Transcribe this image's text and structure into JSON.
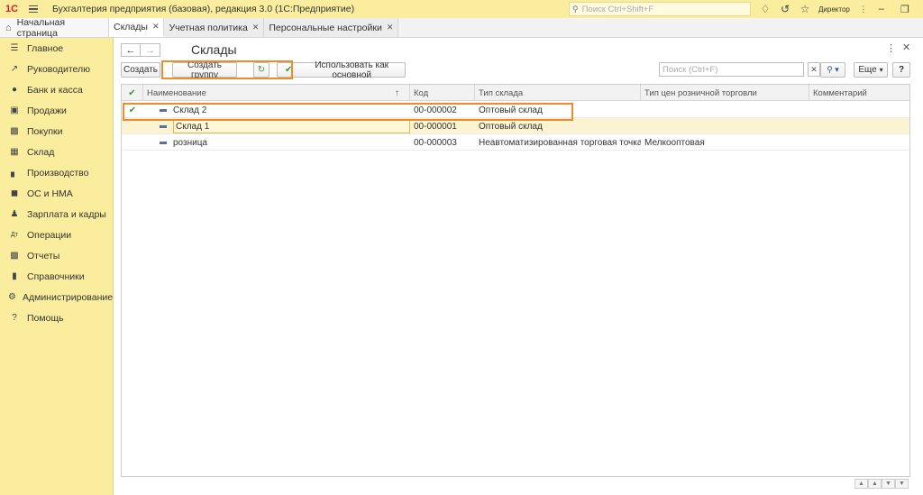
{
  "titlebar": {
    "logo": "1С",
    "title": "Бухгалтерия предприятия (базовая), редакция 3.0  (1С:Предприятие)",
    "search_placeholder": "Поиск Ctrl+Shift+F",
    "user": "Директор"
  },
  "tabs": {
    "home": "Начальная страница",
    "items": [
      {
        "label": "Склады"
      },
      {
        "label": "Учетная политика"
      },
      {
        "label": "Персональные настройки"
      }
    ]
  },
  "sidebar": {
    "items": [
      {
        "label": "Главное",
        "icon": "list-icon"
      },
      {
        "label": "Руководителю",
        "icon": "trend-icon"
      },
      {
        "label": "Банк и касса",
        "icon": "coin-icon"
      },
      {
        "label": "Продажи",
        "icon": "bag-icon"
      },
      {
        "label": "Покупки",
        "icon": "cart-icon"
      },
      {
        "label": "Склад",
        "icon": "box-icon"
      },
      {
        "label": "Производство",
        "icon": "factory-icon"
      },
      {
        "label": "ОС и НМА",
        "icon": "truck-icon"
      },
      {
        "label": "Зарплата и кадры",
        "icon": "person-icon"
      },
      {
        "label": "Операции",
        "icon": "dtkt-icon"
      },
      {
        "label": "Отчеты",
        "icon": "chart-icon"
      },
      {
        "label": "Справочники",
        "icon": "book-icon"
      },
      {
        "label": "Администрирование",
        "icon": "gear-icon"
      },
      {
        "label": "Помощь",
        "icon": "question-icon"
      }
    ]
  },
  "form": {
    "title": "Склады",
    "toolbar": {
      "create": "Создать",
      "create_group": "Создать группу",
      "use_as_main": "Использовать как основной",
      "search_placeholder": "Поиск (Ctrl+F)",
      "more": "Еще",
      "help": "?"
    }
  },
  "table": {
    "columns": [
      "Наименование",
      "Код",
      "Тип склада",
      "Тип цен розничной торговли",
      "Комментарий"
    ],
    "rows": [
      {
        "main": true,
        "name": "Склад 2",
        "code": "00-000002",
        "type": "Оптовый склад",
        "price_type": "",
        "comment": ""
      },
      {
        "main": false,
        "name": "Склад 1",
        "code": "00-000001",
        "type": "Оптовый склад",
        "price_type": "",
        "comment": ""
      },
      {
        "main": false,
        "name": "розница",
        "code": "00-000003",
        "type": "Неавтоматизированная торговая точка",
        "price_type": "Мелкооптовая",
        "comment": ""
      }
    ]
  },
  "colors": {
    "sidebar_bg": "#fbed9e",
    "highlight": "#f08a2a",
    "check_green": "#3a9a3a",
    "selected_row": "#fcf3d0"
  }
}
